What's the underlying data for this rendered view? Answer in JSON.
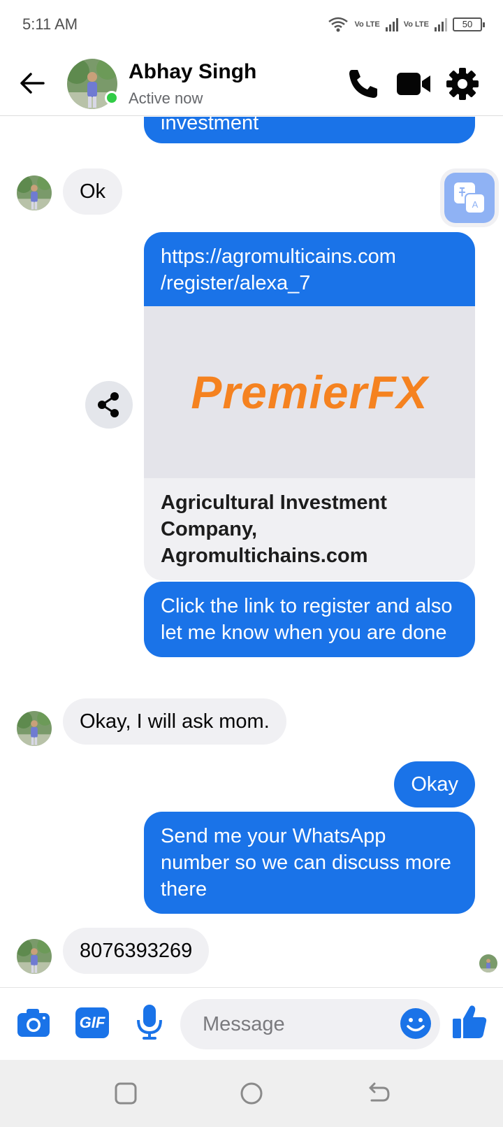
{
  "status_bar": {
    "time": "5:11 AM",
    "volte1": "Vo LTE",
    "volte2": "Vo LTE",
    "battery": "50"
  },
  "header": {
    "contact_name": "Abhay Singh",
    "status": "Active now"
  },
  "messages": {
    "m0_out": "investment",
    "m1_in": "Ok",
    "link_url": "https://agromulticains.com /register/alexa_7",
    "link_brand": "PremierFX",
    "link_title": "Agricultural Investment Company, Agromultichains.com",
    "m3_out": "Click the link to register and also let me know when you are done",
    "m4_in": "Okay, I will ask mom.",
    "m5_out": "Okay",
    "m6_out": "Send me your WhatsApp number so we can discuss more there",
    "m7_in": "8076393269"
  },
  "composer": {
    "placeholder": "Message",
    "gif_label": "GIF"
  },
  "colors": {
    "accent": "#1a73e8",
    "incoming_bubble": "#f0f0f3",
    "online": "#31cc46",
    "brand_orange": "#f58220"
  }
}
